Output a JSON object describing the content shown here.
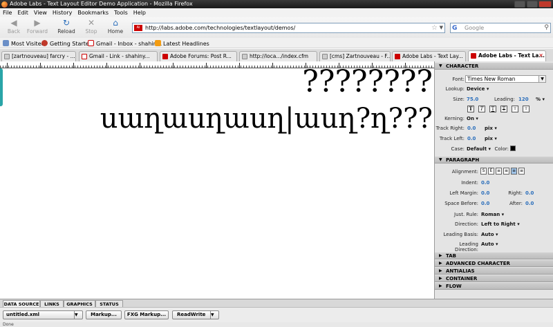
{
  "window": {
    "title": "Adobe Labs - Text Layout Editor Demo Application - Mozilla Firefox"
  },
  "menu": [
    "File",
    "Edit",
    "View",
    "History",
    "Bookmarks",
    "Tools",
    "Help"
  ],
  "nav": {
    "back": "Back",
    "forward": "Forward",
    "reload": "Reload",
    "stop": "Stop",
    "home": "Home"
  },
  "url": "http://labs.adobe.com/technologies/textlayout/demos/",
  "search": {
    "placeholder": "Google"
  },
  "bookmarks": [
    "Most Visited",
    "Getting Started",
    "Gmail - Inbox - shahin...",
    "Latest Headlines"
  ],
  "tabs": [
    "[zartnouveau] farcry - ...",
    "Gmail - Link - shahiny...",
    "Adobe Forums: Post R...",
    "http://loca.../index.cfm",
    "[cms] Zartnouveau - F...",
    "Adobe Labs - Text Lay...",
    "Adobe Labs - Text La..."
  ],
  "editor": {
    "line1": "????????",
    "line2": "սաղասղասղ|ասղ?ղ???"
  },
  "panel": {
    "character": {
      "title": "CHARACTER",
      "font_label": "Font:",
      "font": "Times New Roman",
      "lookup_label": "Lookup:",
      "lookup": "Device",
      "size_label": "Size:",
      "size": "75.0",
      "leading_label": "Leading:",
      "leading": "120",
      "leading_unit": "%",
      "kerning_label": "Kerning:",
      "kerning": "On",
      "track_right_label": "Track Right:",
      "track_right": "0.0",
      "track_right_unit": "pix",
      "track_left_label": "Track Left:",
      "track_left": "0.0",
      "track_left_unit": "pix",
      "case_label": "Case:",
      "case": "Default",
      "color_label": "Color:",
      "style_buttons": [
        "T",
        "T",
        "T",
        "T",
        "T",
        "T"
      ]
    },
    "paragraph": {
      "title": "PARAGRAPH",
      "alignment_label": "Alignment:",
      "indent_label": "Indent:",
      "indent": "0.0",
      "left_margin_label": "Left Margin:",
      "left_margin": "0.0",
      "right_label": "Right:",
      "right": "0.0",
      "space_before_label": "Space Before:",
      "space_before": "0.0",
      "after_label": "After:",
      "after": "0.0",
      "just_rule_label": "Just. Rule:",
      "just_rule": "Roman",
      "direction_label": "Direction:",
      "direction": "Left to Right",
      "leading_basis_label": "Leading Basis:",
      "leading_basis": "Auto",
      "leading_direction_label": "Leading Direction:",
      "leading_direction": "Auto"
    },
    "collapsed": [
      "TAB",
      "ADVANCED CHARACTER",
      "ANTIALIAS",
      "CONTAINER",
      "FLOW"
    ]
  },
  "bottom": {
    "tabs": [
      "DATA SOURCE",
      "LINKS",
      "GRAPHICS",
      "STATUS"
    ],
    "file": "untitled.xml",
    "markup": "Markup...",
    "fxg": "FXG Markup...",
    "mode": "ReadWrite"
  },
  "status": "Done",
  "colors": {
    "accent": "#2a6ebb",
    "handle": "#2aa5a8"
  }
}
